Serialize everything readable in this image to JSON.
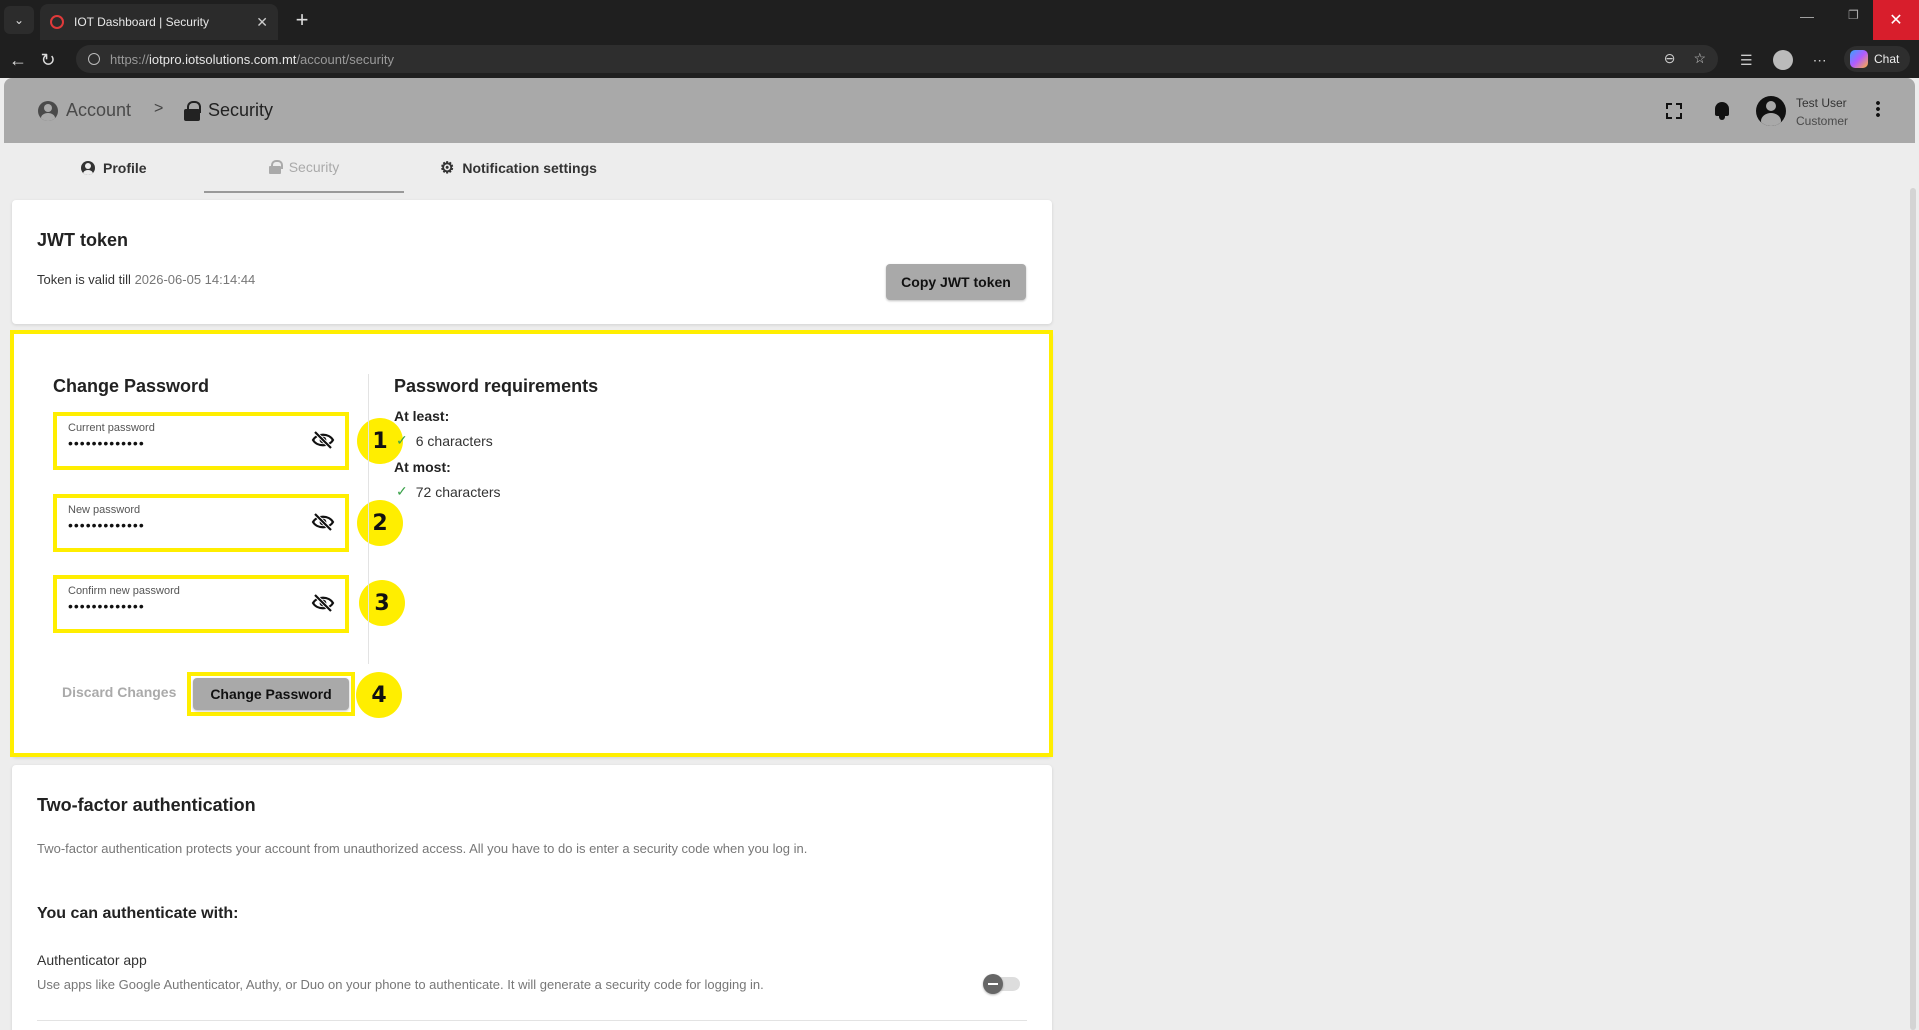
{
  "browser": {
    "tab_title": "IOT Dashboard | Security",
    "url_prefix": "https://",
    "url_host": "iotpro.iotsolutions.com.mt",
    "url_path": "/account/security",
    "chat_label": "Chat"
  },
  "header": {
    "breadcrumb_account": "Account",
    "breadcrumb_separator": ">",
    "breadcrumb_security": "Security",
    "user_name": "Test User",
    "user_role": "Customer"
  },
  "tabs": [
    {
      "label": "Profile"
    },
    {
      "label": "Security"
    },
    {
      "label": "Notification settings"
    }
  ],
  "jwt": {
    "title": "JWT token",
    "valid_prefix": "Token is valid till",
    "valid_date": "2026-06-05 14:14:44",
    "copy_label": "Copy JWT token"
  },
  "change_password": {
    "title": "Change Password",
    "fields": [
      {
        "label": "Current password",
        "value": "•••••••••••••"
      },
      {
        "label": "New password",
        "value": "•••••••••••••"
      },
      {
        "label": "Confirm new password",
        "value": "•••••••••••••"
      }
    ],
    "discard_label": "Discard Changes",
    "submit_label": "Change Password",
    "callouts": [
      "1",
      "2",
      "3",
      "4"
    ]
  },
  "requirements": {
    "title": "Password requirements",
    "at_least_label": "At least:",
    "at_least_item": "6 characters",
    "at_most_label": "At most:",
    "at_most_item": "72 characters"
  },
  "two_factor": {
    "title": "Two-factor authentication",
    "description": "Two-factor authentication protects your account from unauthorized access. All you have to do is enter a security code when you log in.",
    "subtitle": "You can authenticate with:",
    "app_title": "Authenticator app",
    "app_description": "Use apps like Google Authenticator, Authy, or Duo on your phone to authenticate. It will generate a security code for logging in.",
    "app_enabled": false
  },
  "colors": {
    "highlight": "#ffee00",
    "header_bg": "#a9a9a9",
    "check": "#3aa24a"
  }
}
